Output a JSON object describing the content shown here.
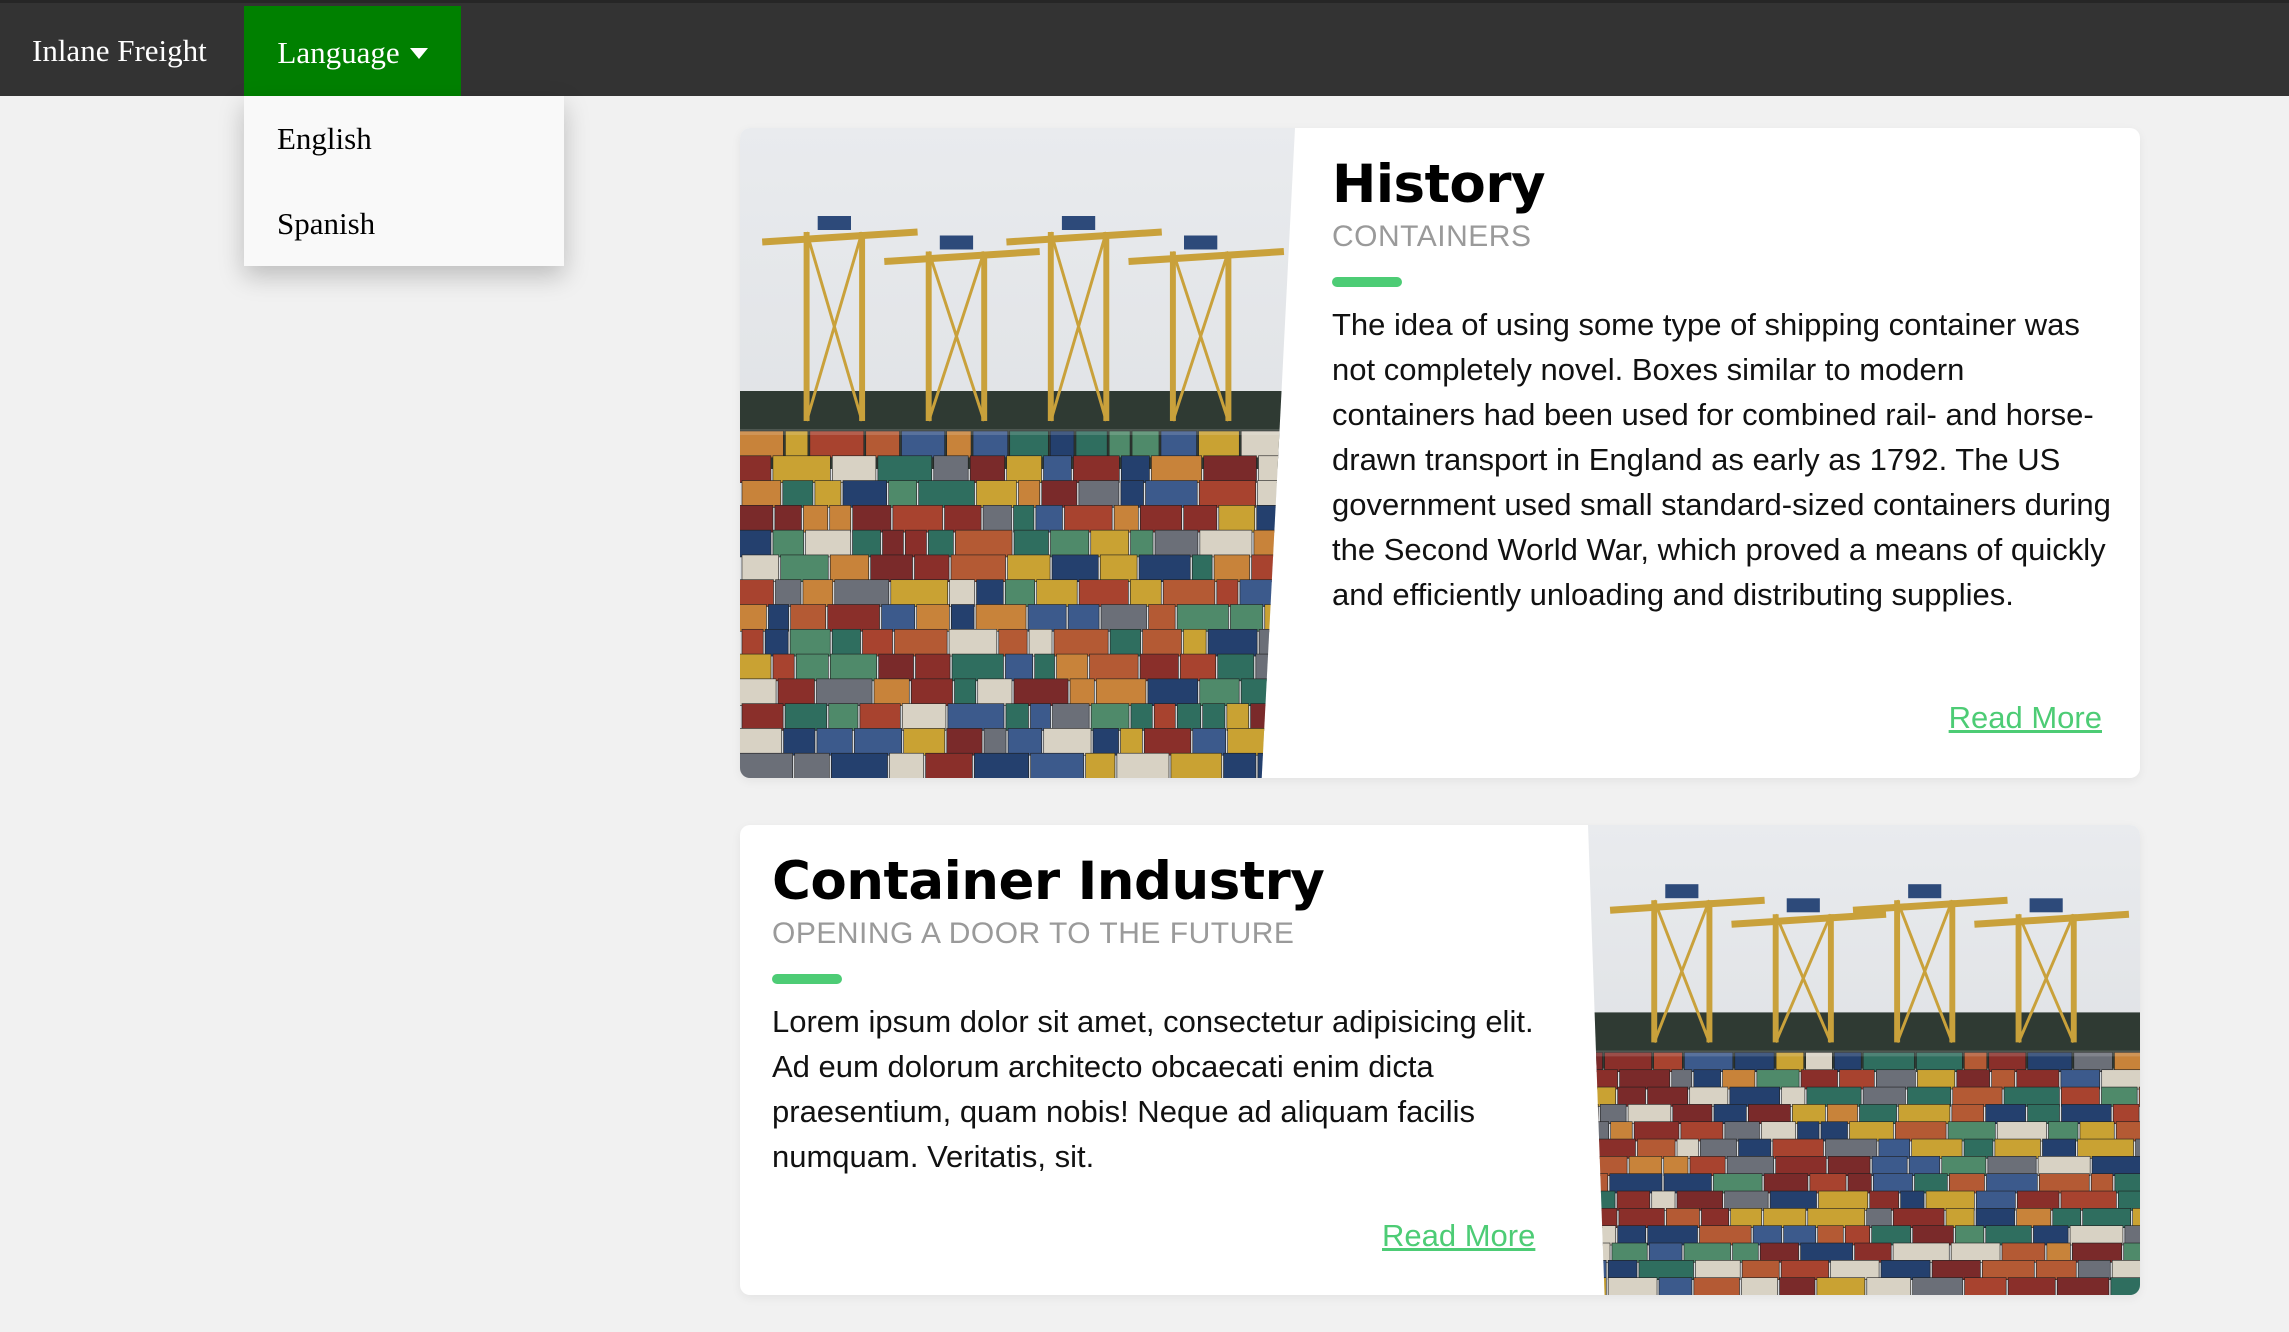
{
  "navbar": {
    "brand": "Inlane Freight",
    "language_label": "Language",
    "dropdown": [
      {
        "label": "English"
      },
      {
        "label": "Spanish"
      }
    ]
  },
  "cards": [
    {
      "title": "History",
      "subtitle": "CONTAINERS",
      "body": "The idea of using some type of shipping container was not completely novel. Boxes similar to modern containers had been used for combined rail- and horse-drawn transport in England as early as 1792. The US government used small standard-sized containers during the Second World War, which proved a means of quickly and efficiently unloading and distributing supplies.",
      "link": "Read More",
      "image": "container-port-photo"
    },
    {
      "title": "Container Industry",
      "subtitle": "OPENING A DOOR TO THE FUTURE",
      "body": "Lorem ipsum dolor sit amet, consectetur adipisicing elit. Ad eum dolorum architecto obcaecati enim dicta praesentium, quam nobis! Neque ad aliquam facilis numquam. Veritatis, sit.",
      "link": "Read More",
      "image": "container-port-photo"
    }
  ],
  "colors": {
    "navbar_bg": "#333333",
    "language_button_bg": "#008000",
    "accent": "#4dcc75",
    "page_bg": "#f1f1f1"
  }
}
